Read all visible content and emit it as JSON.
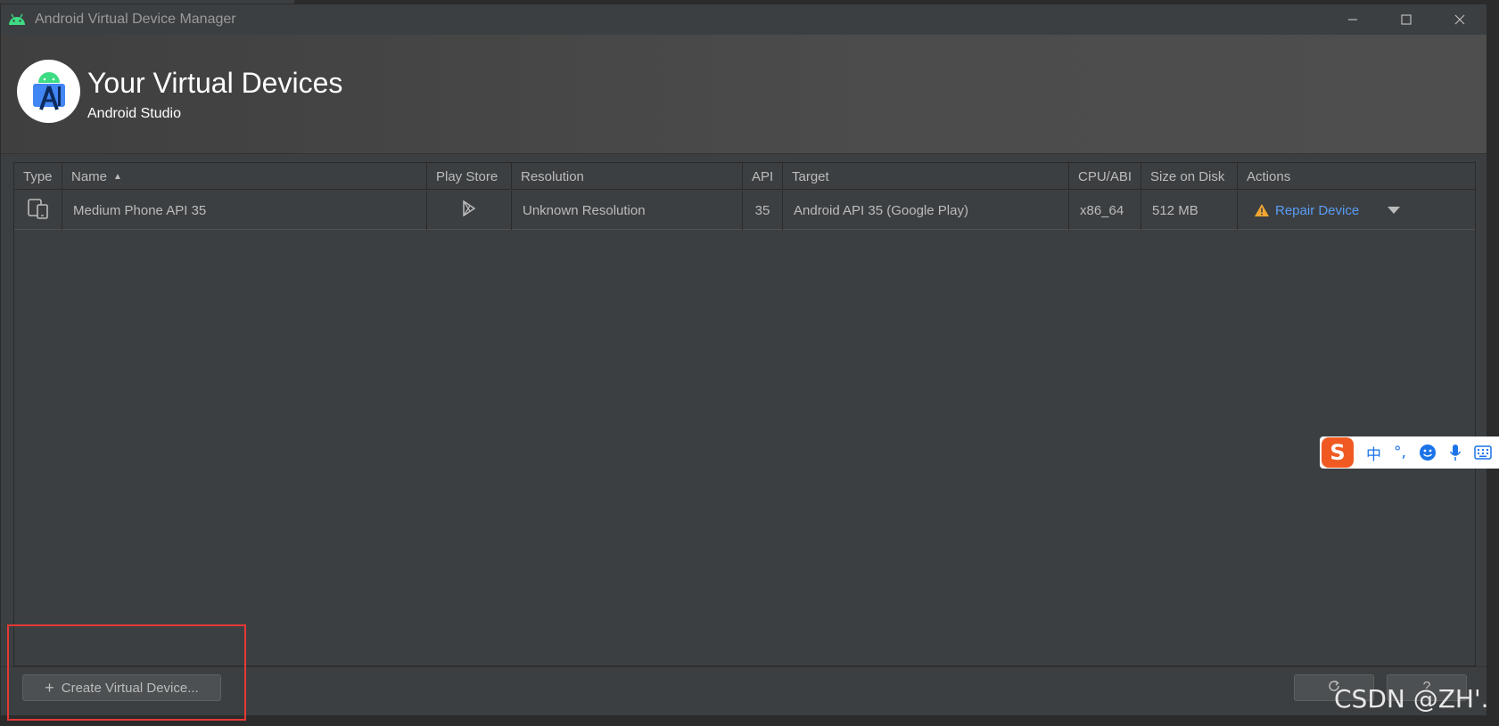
{
  "window": {
    "title": "Android Virtual Device Manager",
    "controls": {
      "minimize": "—",
      "maximize": "☐",
      "close": "✕"
    }
  },
  "banner": {
    "title": "Your Virtual Devices",
    "subtitle": "Android Studio",
    "logo_icon": "android-studio-logo-icon"
  },
  "table": {
    "columns": [
      "Type",
      "Name",
      "Play Store",
      "Resolution",
      "API",
      "Target",
      "CPU/ABI",
      "Size on Disk",
      "Actions"
    ],
    "sort_indicator": "▲",
    "rows": [
      {
        "type_icon": "phone-tablet-icon",
        "name": "Medium Phone API 35",
        "play_store_icon": "play-store-icon",
        "resolution": "Unknown Resolution",
        "api": "35",
        "target": "Android API 35 (Google Play)",
        "cpu_abi": "x86_64",
        "size_on_disk": "512 MB",
        "action_label": "Repair Device",
        "action_icon": "warning-icon",
        "dropdown_icon": "caret-down-icon"
      }
    ]
  },
  "bottom": {
    "create_button": "Create Virtual Device...",
    "create_icon": "+",
    "help_label": "?"
  },
  "ime": {
    "logo": "S",
    "mode": "中",
    "punct": "°,",
    "icons": [
      "emoji-icon",
      "microphone-icon",
      "keyboard-icon"
    ]
  },
  "watermark": "CSDN @ZH'.",
  "colors": {
    "link": "#589df6",
    "warning": "#f0a732",
    "highlight": "#e53935",
    "ime_logo": "#f05a22"
  }
}
